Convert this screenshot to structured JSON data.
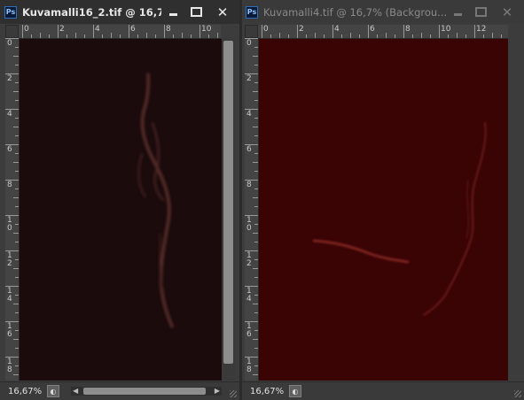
{
  "windows": [
    {
      "app_icon": "Ps",
      "title": "Kuvamalli16_2.tif @ 16,7...",
      "zoom": "16,67%",
      "active": true,
      "canvas_color": "#1b0b0c",
      "h_ruler_labels": [
        "0",
        "2",
        "4",
        "6",
        "8",
        "10"
      ],
      "v_ruler_labels": [
        "0",
        "2",
        "4",
        "6",
        "8",
        "1\n0",
        "1\n2",
        "1\n4",
        "1\n6",
        "1\n8"
      ]
    },
    {
      "app_icon": "Ps",
      "title": "Kuvamalli4.tif @ 16,7% (Backgrou...",
      "zoom": "16,67%",
      "active": false,
      "canvas_color": "#3a0304",
      "h_ruler_labels": [
        "0",
        "2",
        "4",
        "6",
        "8",
        "10",
        "12"
      ],
      "v_ruler_labels": [
        "0",
        "2",
        "4",
        "6",
        "8",
        "1\n0",
        "1\n2",
        "1\n4",
        "1\n6",
        "1\n8"
      ]
    }
  ],
  "icons": {
    "minimize": "minimize-icon",
    "maximize": "maximize-icon",
    "close": "close-icon",
    "close_glyph": "✕",
    "scroll_left_glyph": "◀",
    "scroll_right_glyph": "▶"
  }
}
